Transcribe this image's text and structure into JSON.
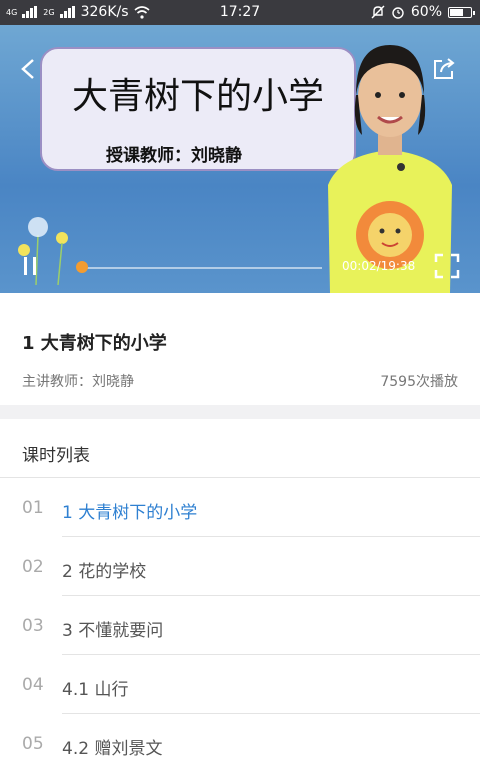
{
  "status_bar": {
    "network_left": "4G",
    "network_right": "2G",
    "speed": "326K/s",
    "time": "17:27",
    "battery": "60%",
    "battery_level": 0.6
  },
  "video": {
    "slide_title": "大青树下的小学",
    "slide_subtitle": "授课教师：刘晓静",
    "time_display": "00:02/19:38",
    "progress": 0.0017
  },
  "lesson": {
    "title": "1 大青树下的小学",
    "teacher": "主讲教师：刘晓静",
    "plays": "7595次播放"
  },
  "list": {
    "header": "课时列表",
    "items": [
      {
        "num": "01",
        "name": "1 大青树下的小学",
        "active": true
      },
      {
        "num": "02",
        "name": "2 花的学校"
      },
      {
        "num": "03",
        "name": "3 不懂就要问"
      },
      {
        "num": "04",
        "name": "4.1 山行"
      },
      {
        "num": "05",
        "name": "4.2 赠刘景文"
      }
    ]
  },
  "colors": {
    "accent": "#2f80d1",
    "progress": "#f39c30",
    "status_bar": "#3a3a3f"
  }
}
